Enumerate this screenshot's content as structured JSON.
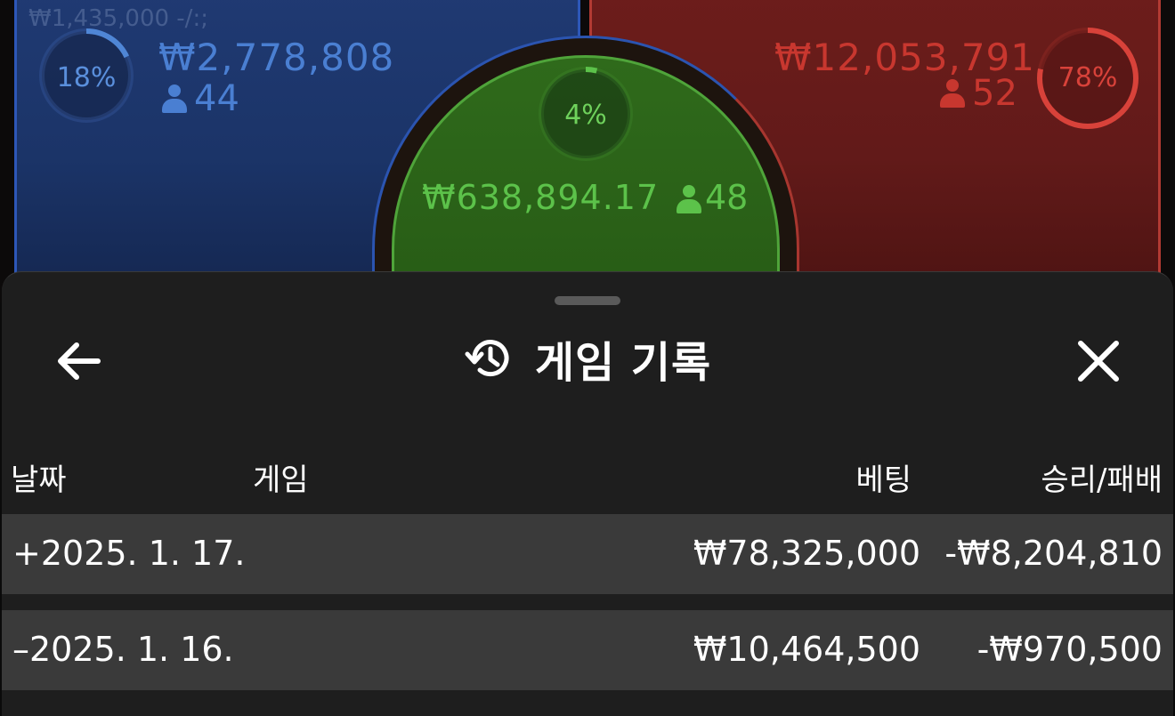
{
  "board": {
    "blue": {
      "ghost_text": "₩1,435,000  -/:;",
      "percent": "18%",
      "percent_value": 18,
      "amount": "₩2,778,808",
      "players": "44",
      "color": "#4f86d6"
    },
    "green": {
      "percent": "4%",
      "percent_value": 4,
      "amount": "₩638,894.17",
      "players": "48",
      "color": "#5cc24a"
    },
    "red": {
      "percent": "78%",
      "percent_value": 78,
      "amount": "₩12,053,791",
      "players": "52",
      "color": "#d8423a"
    }
  },
  "sheet": {
    "title": "게임 기록",
    "icons": {
      "back": "arrow-left-icon",
      "history": "history-icon",
      "close": "close-icon"
    }
  },
  "table": {
    "columns": [
      "날짜",
      "게임",
      "베팅",
      "승리/패배"
    ],
    "rows": [
      {
        "date": "+2025. 1. 17.",
        "game": "",
        "bet": "₩78,325,000",
        "result": "-₩8,204,810"
      },
      {
        "date": "–2025. 1. 16.",
        "game": "",
        "bet": "₩10,464,500",
        "result": "-₩970,500"
      }
    ]
  }
}
